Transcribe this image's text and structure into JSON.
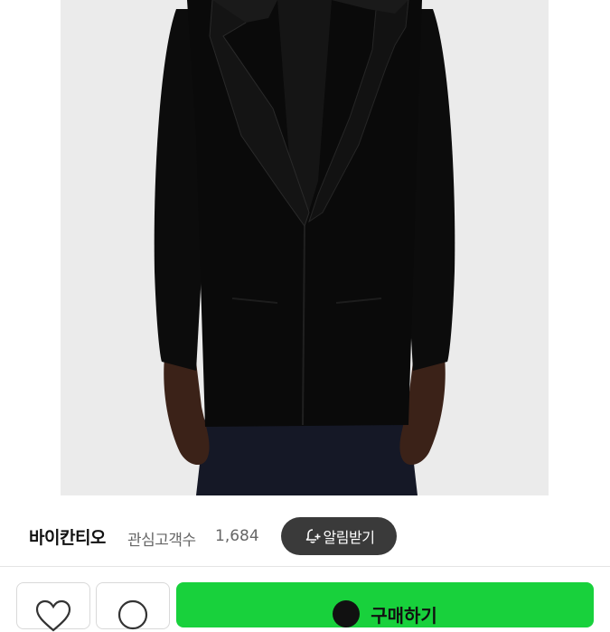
{
  "store": {
    "name": "바이칸티오",
    "follower_label": "관심고객수",
    "follower_count": "1,684",
    "notify_button_label": "알림받기"
  },
  "actions": {
    "buy_label": "구매하기"
  },
  "colors": {
    "buy_button": "#18d13c",
    "notify_button": "#3a3a3a",
    "photo_backdrop": "#ebebeb"
  },
  "icons": [
    "bell-plus-icon",
    "heart-icon",
    "chat-bubble-icon"
  ]
}
